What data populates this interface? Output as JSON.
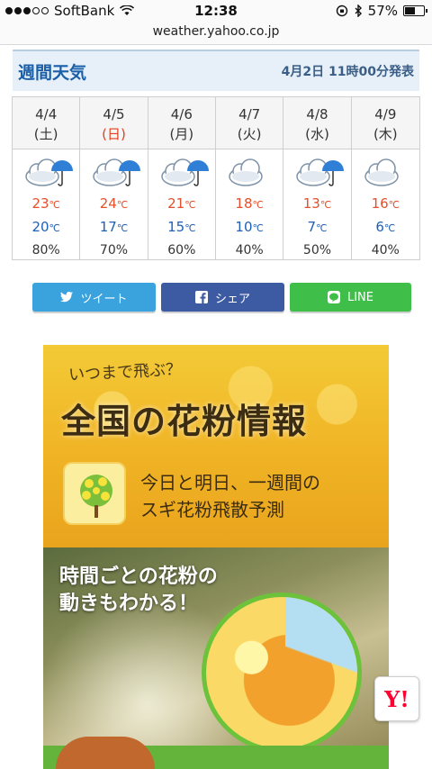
{
  "status_bar": {
    "carrier": "SoftBank",
    "time": "12:38",
    "battery": "57%",
    "battery_level": 0.57,
    "signal_bars_filled": 3,
    "signal_bars_total": 5
  },
  "url": "weather.yahoo.co.jp",
  "weekly": {
    "title": "週間天気",
    "issued": "4月2日 11時00分発表",
    "days": [
      {
        "date": "4/4",
        "dow": "(土)",
        "weekend": false,
        "icon": "cloud-rain-icon",
        "high": "23",
        "low": "20",
        "rain": "80%"
      },
      {
        "date": "4/5",
        "dow": "(日)",
        "weekend": true,
        "icon": "cloud-rain-icon",
        "high": "24",
        "low": "17",
        "rain": "70%"
      },
      {
        "date": "4/6",
        "dow": "(月)",
        "weekend": false,
        "icon": "cloud-rain-icon",
        "high": "21",
        "low": "15",
        "rain": "60%"
      },
      {
        "date": "4/7",
        "dow": "(火)",
        "weekend": false,
        "icon": "cloud-icon",
        "high": "18",
        "low": "10",
        "rain": "40%"
      },
      {
        "date": "4/8",
        "dow": "(水)",
        "weekend": false,
        "icon": "cloud-rain-icon",
        "high": "13",
        "low": "7",
        "rain": "50%"
      },
      {
        "date": "4/9",
        "dow": "(木)",
        "weekend": false,
        "icon": "cloud-icon",
        "high": "16",
        "low": "6",
        "rain": "40%"
      }
    ],
    "unit": "℃"
  },
  "share": {
    "tweet": "ツイート",
    "share": "シェア",
    "line": "LINE"
  },
  "banner": {
    "subtitle": "いつまで飛ぶ？",
    "title": "全国の花粉情報",
    "desc_line1": "今日と明日、一週間の",
    "desc_line2": "スギ花粉飛散予測",
    "caption_line1": "時間ごとの花粉の",
    "caption_line2": "動きもわかる！"
  },
  "yahoo_button": "Y!",
  "colors": {
    "title_blue": "#1a5fa8",
    "high_red": "#e5502a",
    "low_blue": "#1f5fb6",
    "sunday_red": "#e0401f",
    "twitter": "#3aa2dd",
    "facebook": "#3c5ba3",
    "line": "#3fbe4a"
  }
}
